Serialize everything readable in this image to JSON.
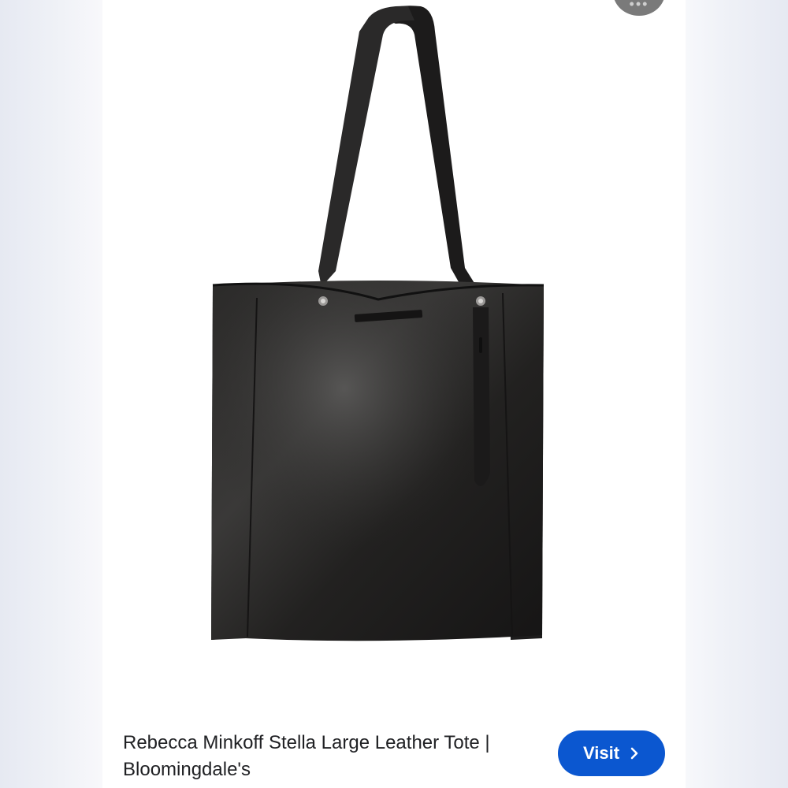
{
  "header": {
    "more_button_icon": "more-horizontal-icon"
  },
  "result": {
    "title": "Rebecca Minkoff Stella Large Leather Tote | Bloomingdale's",
    "visit_label": "Visit",
    "visit_icon": "chevron-right-icon",
    "visit_color": "#0b57d0"
  },
  "image": {
    "subject": "black-leather-tote-bag"
  }
}
